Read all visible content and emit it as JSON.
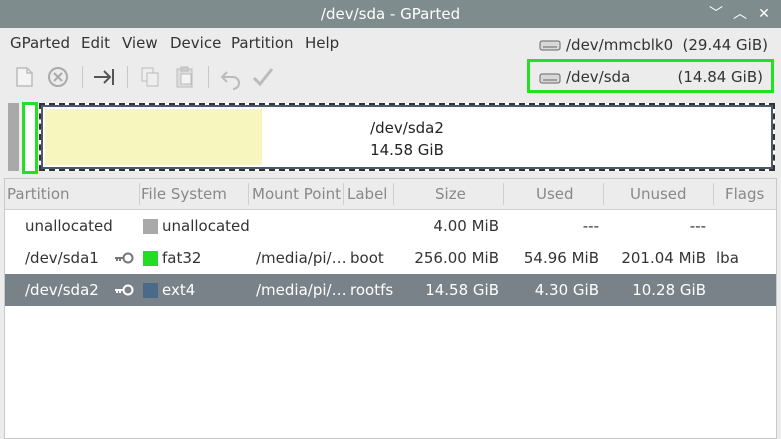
{
  "window": {
    "title": "/dev/sda - GParted"
  },
  "menu": [
    "GParted",
    "Edit",
    "View",
    "Device",
    "Partition",
    "Help"
  ],
  "toolbar_icons": [
    "new-icon",
    "delete-icon",
    "resize-move-icon",
    "copy-icon",
    "paste-icon",
    "undo-icon",
    "apply-icon"
  ],
  "devices": [
    {
      "name": "/dev/mmcblk0",
      "size": "(29.44 GiB)"
    },
    {
      "name": "/dev/sda",
      "size": "(14.84 GiB)",
      "selected": true
    }
  ],
  "diskmap": {
    "partition": "/dev/sda2",
    "size": "14.58 GiB",
    "used_fraction": 0.3
  },
  "columns": [
    "Partition",
    "File System",
    "Mount Point",
    "Label",
    "Size",
    "Used",
    "Unused",
    "Flags"
  ],
  "rows": [
    {
      "partition": "unallocated",
      "key": false,
      "fs": "unallocated",
      "fs_color": "#a9a9a9",
      "mount": "",
      "label": "",
      "size": "4.00 MiB",
      "used": "---",
      "unused": "---",
      "flags": ""
    },
    {
      "partition": "/dev/sda1",
      "key": true,
      "fs": "fat32",
      "fs_color": "#22dd22",
      "mount": "/media/pi/…",
      "label": "boot",
      "size": "256.00 MiB",
      "used": "54.96 MiB",
      "unused": "201.04 MiB",
      "flags": "lba"
    },
    {
      "partition": "/dev/sda2",
      "key": true,
      "fs": "ext4",
      "fs_color": "#4a6a8a",
      "mount": "/media/pi/…",
      "label": "rootfs",
      "size": "14.58 GiB",
      "used": "4.30 GiB",
      "unused": "10.28 GiB",
      "flags": "",
      "selected": true
    }
  ]
}
